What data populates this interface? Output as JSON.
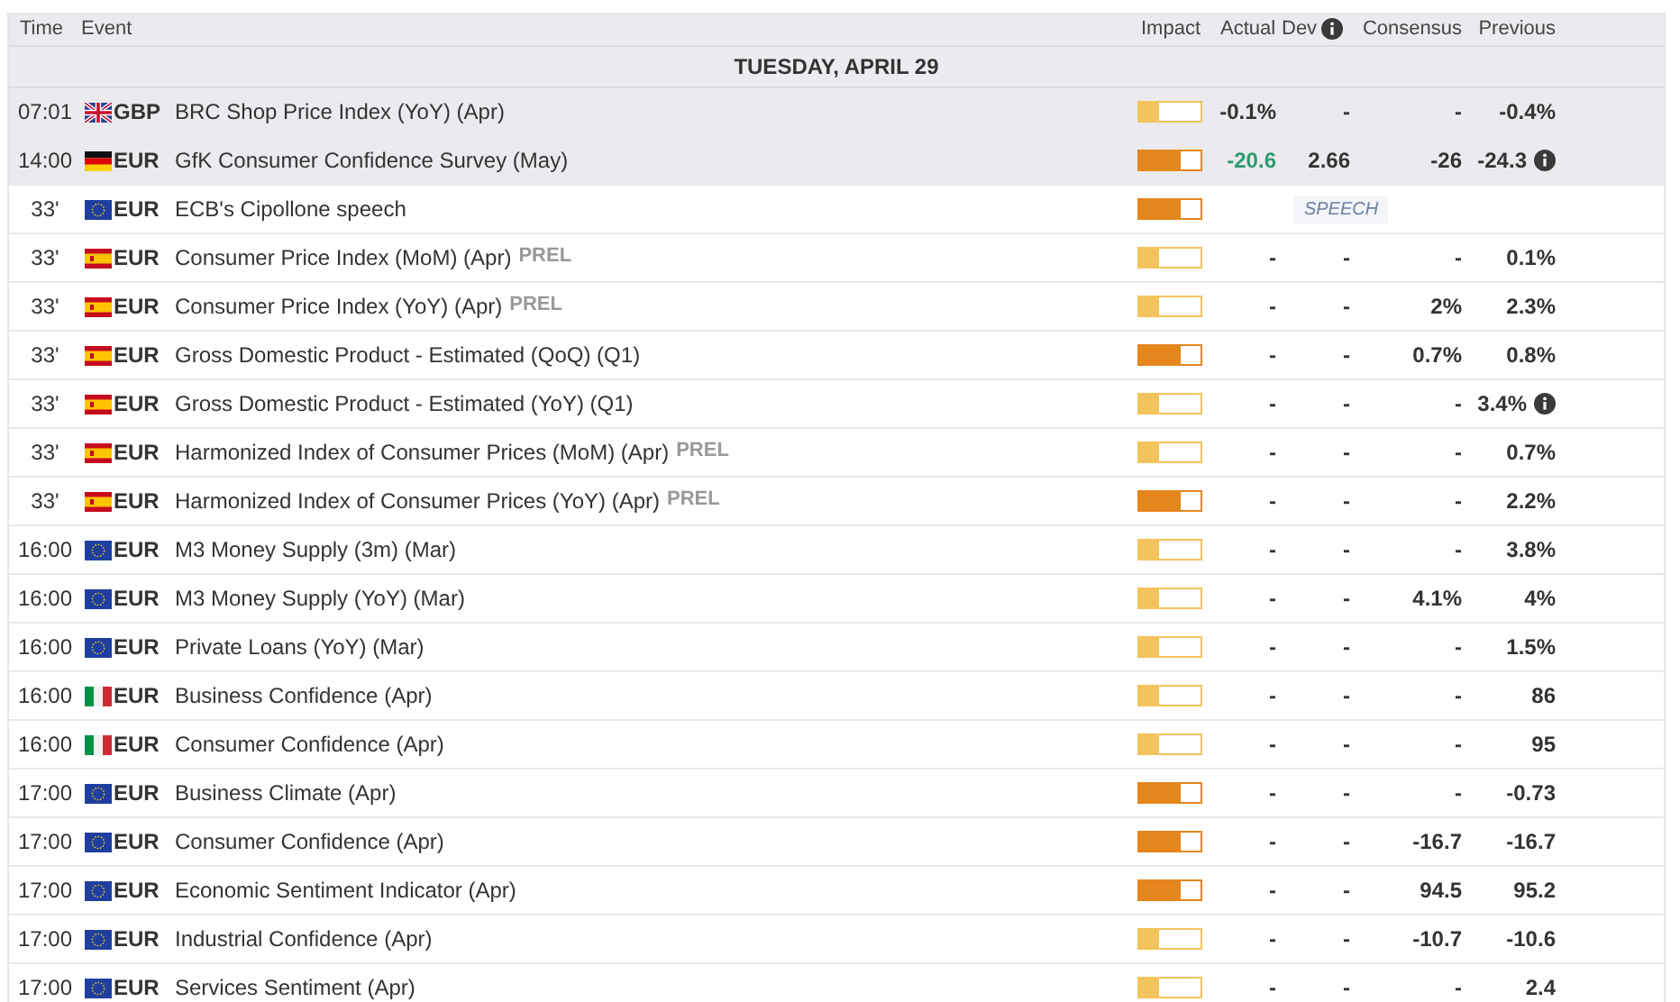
{
  "columns": [
    {
      "label": "Time"
    },
    {
      "label": "Event"
    },
    {
      "label": "Impact"
    },
    {
      "label": "Actual"
    },
    {
      "label": "Dev",
      "info": true
    },
    {
      "label": "Consensus"
    },
    {
      "label": "Previous"
    }
  ],
  "date_header": "TUESDAY, APRIL 29",
  "rows": [
    {
      "kind": "data",
      "released": true,
      "time": "07:01",
      "flag": {
        "kind": "gb"
      },
      "currency": "GBP",
      "event": "BRC Shop Price Index (YoY) (Apr)",
      "impact": {
        "level": 0.33
      },
      "actual": {
        "text": "-0.1%",
        "color": "#333333"
      },
      "dev": "-",
      "consensus": "-",
      "previous": "-0.4%",
      "previous_note": false
    },
    {
      "kind": "data",
      "released": true,
      "time": "14:00",
      "flag": {
        "kind": "de"
      },
      "currency": "EUR",
      "event": "GfK Consumer Confidence Survey (May)",
      "impact": {
        "level": 0.67
      },
      "actual": {
        "text": "-20.6",
        "color": "#2e9a6e"
      },
      "dev": "2.66",
      "consensus": "-26",
      "previous": "-24.3",
      "previous_note": true
    },
    {
      "kind": "speech",
      "released": false,
      "time": "33'",
      "flag": {
        "kind": "eu"
      },
      "currency": "EUR",
      "event": "ECB's Cipollone speech",
      "impact": {
        "level": 0.67
      },
      "label": "SPEECH"
    },
    {
      "kind": "data",
      "released": false,
      "time": "33'",
      "flag": {
        "kind": "es"
      },
      "currency": "EUR",
      "event": "Consumer Price Index (MoM) (Apr)",
      "tag": "PREL",
      "impact": {
        "level": 0.33
      },
      "actual": {
        "text": "-",
        "color": "#333333"
      },
      "dev": "-",
      "consensus": "-",
      "previous": "0.1%",
      "previous_note": false
    },
    {
      "kind": "data",
      "released": false,
      "time": "33'",
      "flag": {
        "kind": "es"
      },
      "currency": "EUR",
      "event": "Consumer Price Index (YoY) (Apr)",
      "tag": "PREL",
      "impact": {
        "level": 0.33
      },
      "actual": {
        "text": "-",
        "color": "#333333"
      },
      "dev": "-",
      "consensus": "2%",
      "previous": "2.3%",
      "previous_note": false
    },
    {
      "kind": "data",
      "released": false,
      "time": "33'",
      "flag": {
        "kind": "es"
      },
      "currency": "EUR",
      "event": "Gross Domestic Product - Estimated (QoQ) (Q1)",
      "impact": {
        "level": 0.67
      },
      "actual": {
        "text": "-",
        "color": "#333333"
      },
      "dev": "-",
      "consensus": "0.7%",
      "previous": "0.8%",
      "previous_note": false
    },
    {
      "kind": "data",
      "released": false,
      "time": "33'",
      "flag": {
        "kind": "es"
      },
      "currency": "EUR",
      "event": "Gross Domestic Product - Estimated (YoY) (Q1)",
      "impact": {
        "level": 0.33
      },
      "actual": {
        "text": "-",
        "color": "#333333"
      },
      "dev": "-",
      "consensus": "-",
      "previous": "3.4%",
      "previous_note": true
    },
    {
      "kind": "data",
      "released": false,
      "time": "33'",
      "flag": {
        "kind": "es"
      },
      "currency": "EUR",
      "event": "Harmonized Index of Consumer Prices (MoM) (Apr)",
      "tag": "PREL",
      "impact": {
        "level": 0.33
      },
      "actual": {
        "text": "-",
        "color": "#333333"
      },
      "dev": "-",
      "consensus": "-",
      "previous": "0.7%",
      "previous_note": false
    },
    {
      "kind": "data",
      "released": false,
      "time": "33'",
      "flag": {
        "kind": "es"
      },
      "currency": "EUR",
      "event": "Harmonized Index of Consumer Prices (YoY) (Apr)",
      "tag": "PREL",
      "impact": {
        "level": 0.67
      },
      "actual": {
        "text": "-",
        "color": "#333333"
      },
      "dev": "-",
      "consensus": "-",
      "previous": "2.2%",
      "previous_note": false
    },
    {
      "kind": "data",
      "released": false,
      "time": "16:00",
      "flag": {
        "kind": "eu"
      },
      "currency": "EUR",
      "event": "M3 Money Supply (3m) (Mar)",
      "impact": {
        "level": 0.33
      },
      "actual": {
        "text": "-",
        "color": "#333333"
      },
      "dev": "-",
      "consensus": "-",
      "previous": "3.8%",
      "previous_note": false
    },
    {
      "kind": "data",
      "released": false,
      "time": "16:00",
      "flag": {
        "kind": "eu"
      },
      "currency": "EUR",
      "event": "M3 Money Supply (YoY) (Mar)",
      "impact": {
        "level": 0.33
      },
      "actual": {
        "text": "-",
        "color": "#333333"
      },
      "dev": "-",
      "consensus": "4.1%",
      "previous": "4%",
      "previous_note": false
    },
    {
      "kind": "data",
      "released": false,
      "time": "16:00",
      "flag": {
        "kind": "eu"
      },
      "currency": "EUR",
      "event": "Private Loans (YoY) (Mar)",
      "impact": {
        "level": 0.33
      },
      "actual": {
        "text": "-",
        "color": "#333333"
      },
      "dev": "-",
      "consensus": "-",
      "previous": "1.5%",
      "previous_note": false
    },
    {
      "kind": "data",
      "released": false,
      "time": "16:00",
      "flag": {
        "kind": "it"
      },
      "currency": "EUR",
      "event": "Business Confidence (Apr)",
      "impact": {
        "level": 0.33
      },
      "actual": {
        "text": "-",
        "color": "#333333"
      },
      "dev": "-",
      "consensus": "-",
      "previous": "86",
      "previous_note": false
    },
    {
      "kind": "data",
      "released": false,
      "time": "16:00",
      "flag": {
        "kind": "it"
      },
      "currency": "EUR",
      "event": "Consumer Confidence (Apr)",
      "impact": {
        "level": 0.33
      },
      "actual": {
        "text": "-",
        "color": "#333333"
      },
      "dev": "-",
      "consensus": "-",
      "previous": "95",
      "previous_note": false
    },
    {
      "kind": "data",
      "released": false,
      "time": "17:00",
      "flag": {
        "kind": "eu"
      },
      "currency": "EUR",
      "event": "Business Climate (Apr)",
      "impact": {
        "level": 0.67
      },
      "actual": {
        "text": "-",
        "color": "#333333"
      },
      "dev": "-",
      "consensus": "-",
      "previous": "-0.73",
      "previous_note": false
    },
    {
      "kind": "data",
      "released": false,
      "time": "17:00",
      "flag": {
        "kind": "eu"
      },
      "currency": "EUR",
      "event": "Consumer Confidence (Apr)",
      "impact": {
        "level": 0.67
      },
      "actual": {
        "text": "-",
        "color": "#333333"
      },
      "dev": "-",
      "consensus": "-16.7",
      "previous": "-16.7",
      "previous_note": false
    },
    {
      "kind": "data",
      "released": false,
      "time": "17:00",
      "flag": {
        "kind": "eu"
      },
      "currency": "EUR",
      "event": "Economic Sentiment Indicator (Apr)",
      "impact": {
        "level": 0.67
      },
      "actual": {
        "text": "-",
        "color": "#333333"
      },
      "dev": "-",
      "consensus": "94.5",
      "previous": "95.2",
      "previous_note": false
    },
    {
      "kind": "data",
      "released": false,
      "time": "17:00",
      "flag": {
        "kind": "eu"
      },
      "currency": "EUR",
      "event": "Industrial Confidence (Apr)",
      "impact": {
        "level": 0.33
      },
      "actual": {
        "text": "-",
        "color": "#333333"
      },
      "dev": "-",
      "consensus": "-10.7",
      "previous": "-10.6",
      "previous_note": false
    },
    {
      "kind": "data",
      "released": false,
      "time": "17:00",
      "flag": {
        "kind": "eu"
      },
      "currency": "EUR",
      "event": "Services Sentiment (Apr)",
      "impact": {
        "level": 0.33
      },
      "actual": {
        "text": "-",
        "color": "#333333"
      },
      "dev": "-",
      "consensus": "-",
      "previous": "2.4",
      "previous_note": false
    }
  ]
}
